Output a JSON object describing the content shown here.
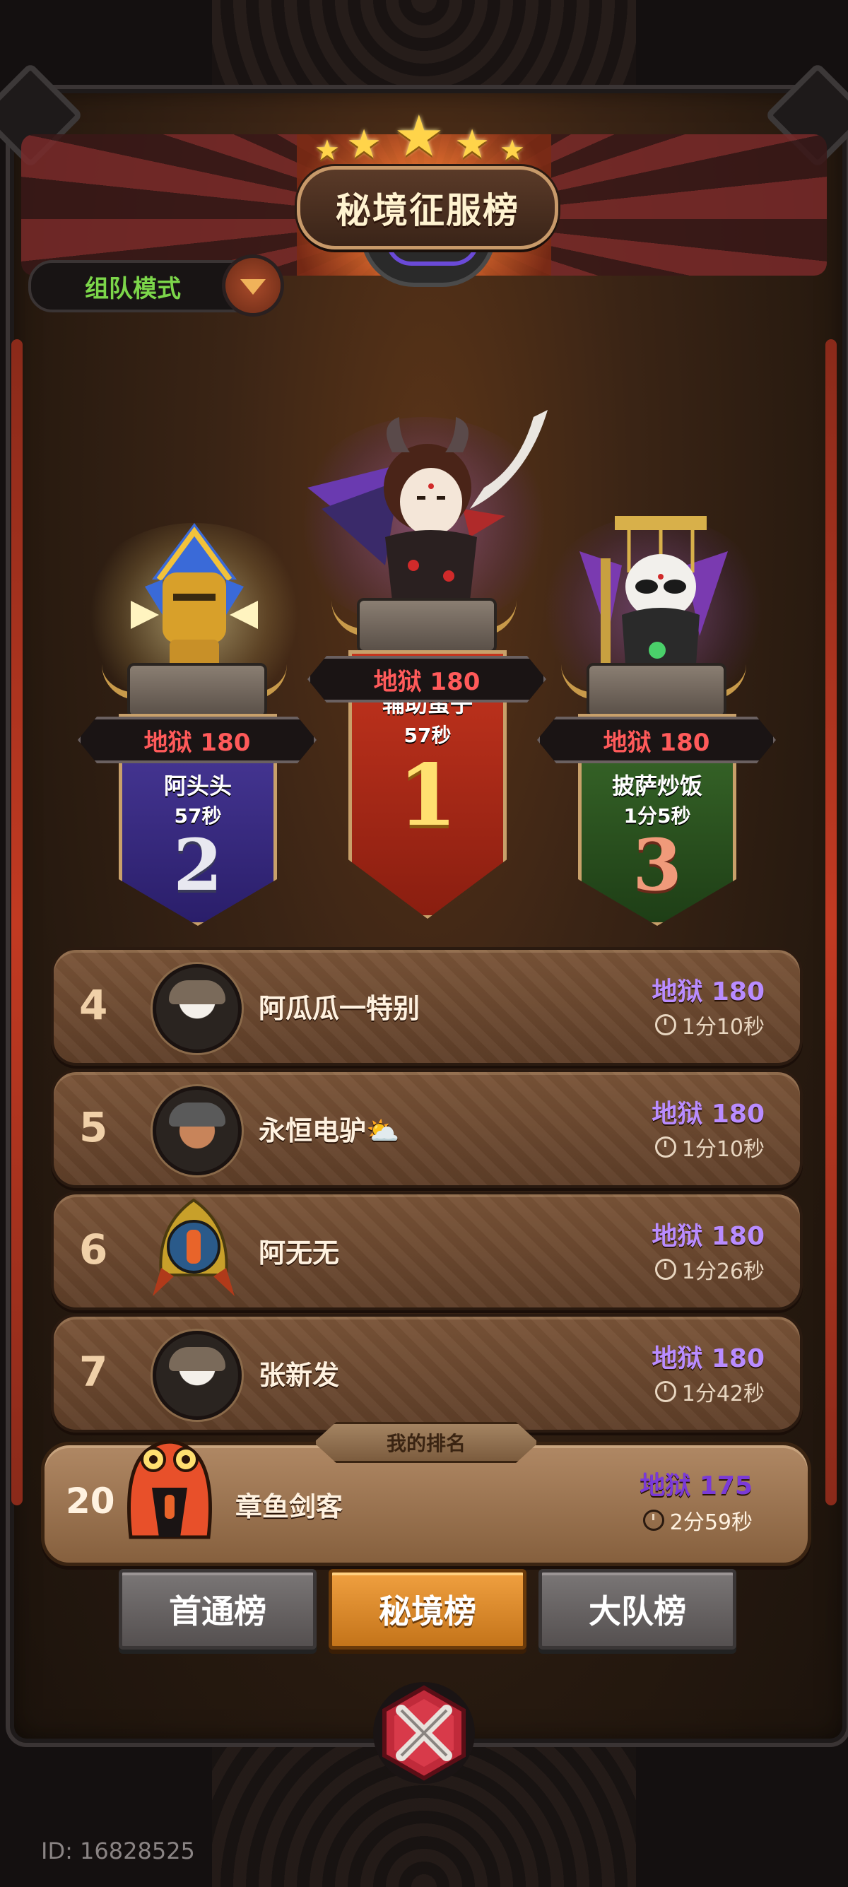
{
  "header": {
    "title": "秘境征服榜",
    "mode_label": "组队模式"
  },
  "podium": {
    "first": {
      "rank": "1",
      "level": "地狱 180",
      "name": "辅助蛮子",
      "time": "57秒"
    },
    "second": {
      "rank": "2",
      "level": "地狱 180",
      "name": "阿头头",
      "time": "57秒"
    },
    "third": {
      "rank": "3",
      "level": "地狱 180",
      "name": "披萨炒饭",
      "time": "1分5秒"
    }
  },
  "rankings": [
    {
      "rank": "4",
      "name": "阿瓜瓜一特别",
      "level": "地狱 180",
      "time": "1分10秒"
    },
    {
      "rank": "5",
      "name": "永恒电驴⛅",
      "level": "地狱 180",
      "time": "1分10秒"
    },
    {
      "rank": "6",
      "name": "阿无无",
      "level": "地狱 180",
      "time": "1分26秒"
    },
    {
      "rank": "7",
      "name": "张新发",
      "level": "地狱 180",
      "time": "1分42秒"
    }
  ],
  "my_rank": {
    "tag": "我的排名",
    "rank": "20",
    "name": "章鱼剑客",
    "level": "地狱 175",
    "time": "2分59秒"
  },
  "tabs": [
    {
      "label": "首通榜",
      "active": false
    },
    {
      "label": "秘境榜",
      "active": true
    },
    {
      "label": "大队榜",
      "active": false
    }
  ],
  "footer": {
    "id": "ID: 16828525"
  },
  "colors": {
    "level_purple": "#b98cff",
    "level_red": "#ff5a5a",
    "mode_green": "#7cd64a",
    "tab_active": "#e08a2a"
  }
}
